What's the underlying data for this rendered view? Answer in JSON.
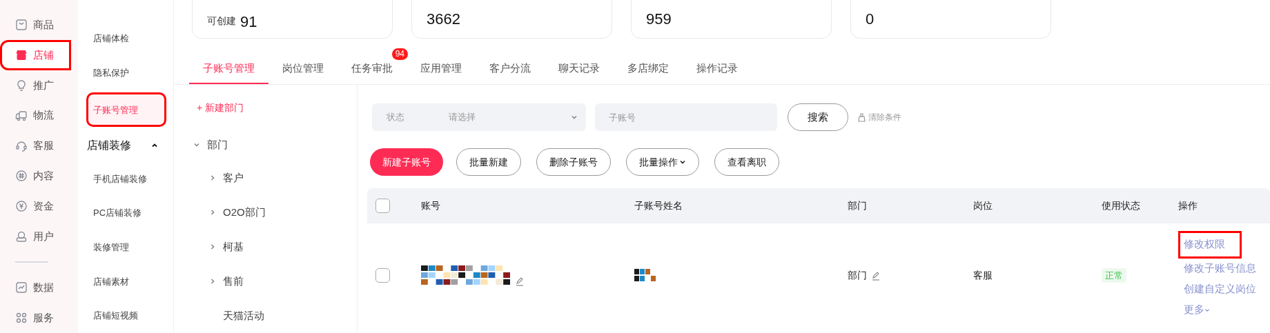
{
  "nav": {
    "primary": [
      {
        "label": "商品",
        "selected": false,
        "highlighted": false
      },
      {
        "label": "店铺",
        "selected": true,
        "highlighted": true
      },
      {
        "label": "推广",
        "selected": false,
        "highlighted": false
      },
      {
        "label": "物流",
        "selected": false,
        "highlighted": false
      },
      {
        "label": "客服",
        "selected": false,
        "highlighted": false
      },
      {
        "label": "内容",
        "selected": false,
        "highlighted": false
      },
      {
        "label": "资金",
        "selected": false,
        "highlighted": false
      },
      {
        "label": "用户",
        "selected": false,
        "highlighted": false
      }
    ],
    "secondary": [
      {
        "label": "数据",
        "selected": false,
        "highlighted": false
      },
      {
        "label": "服务",
        "selected": false,
        "highlighted": false
      }
    ]
  },
  "submenu": {
    "items": [
      {
        "label": "店铺体检",
        "selected": false,
        "highlighted": false
      },
      {
        "label": "隐私保护",
        "selected": false,
        "highlighted": false
      },
      {
        "label": "子账号管理",
        "selected": true,
        "highlighted": true
      }
    ],
    "group": {
      "label": "店铺装修",
      "expanded": true,
      "items": [
        {
          "label": "手机店铺装修",
          "selected": false
        },
        {
          "label": "PC店铺装修",
          "selected": false
        },
        {
          "label": "装修管理",
          "selected": false
        },
        {
          "label": "店铺素材",
          "selected": false
        },
        {
          "label": "店铺短视频",
          "selected": false
        }
      ]
    }
  },
  "stat_cards": [
    {
      "label": "可创建",
      "value": "91"
    },
    {
      "value": "3662"
    },
    {
      "value": "959"
    },
    {
      "value": "0"
    }
  ],
  "tabs": [
    {
      "label": "子账号管理",
      "selected": true
    },
    {
      "label": "岗位管理",
      "selected": false
    },
    {
      "label": "任务审批",
      "selected": false,
      "badge": "94"
    },
    {
      "label": "应用管理",
      "selected": false
    },
    {
      "label": "客户分流",
      "selected": false
    },
    {
      "label": "聊天记录",
      "selected": false
    },
    {
      "label": "多店绑定",
      "selected": false
    },
    {
      "label": "操作记录",
      "selected": false
    }
  ],
  "department_tree": {
    "new_button": "+ 新建部门",
    "nodes": [
      {
        "label": "部门",
        "expanded": true,
        "children": [
          {
            "label": "客户",
            "expandable": true
          },
          {
            "label": "O2O部门",
            "expandable": true
          },
          {
            "label": "柯基",
            "expandable": true
          },
          {
            "label": "售前",
            "expandable": true
          },
          {
            "label": "天猫活动",
            "expandable": false
          }
        ]
      }
    ]
  },
  "filters": {
    "status_label": "状态",
    "status_placeholder": "请选择",
    "account_placeholder": "子账号",
    "search_button": "搜索",
    "clear_link": "清除条件"
  },
  "actions": [
    {
      "label": "新建子账号",
      "primary": true,
      "dropdown": false
    },
    {
      "label": "批量新建",
      "primary": false,
      "dropdown": false
    },
    {
      "label": "删除子账号",
      "primary": false,
      "dropdown": false
    },
    {
      "label": "批量操作",
      "primary": false,
      "dropdown": true
    },
    {
      "label": "查看离职",
      "primary": false,
      "dropdown": false
    }
  ],
  "table": {
    "all_checked": false,
    "columns": [
      "账号",
      "子账号姓名",
      "部门",
      "岗位",
      "使用状态",
      "操作"
    ],
    "rows": [
      {
        "checked": false,
        "department": "部门",
        "position": "客服",
        "status": "正常",
        "row_actions": [
          {
            "label": "修改权限",
            "highlighted": true,
            "dropdown": false
          },
          {
            "label": "修改子账号信息",
            "highlighted": false,
            "dropdown": false
          },
          {
            "label": "创建自定义岗位",
            "highlighted": false,
            "dropdown": false
          },
          {
            "label": "更多",
            "highlighted": false,
            "dropdown": true
          }
        ]
      }
    ]
  }
}
